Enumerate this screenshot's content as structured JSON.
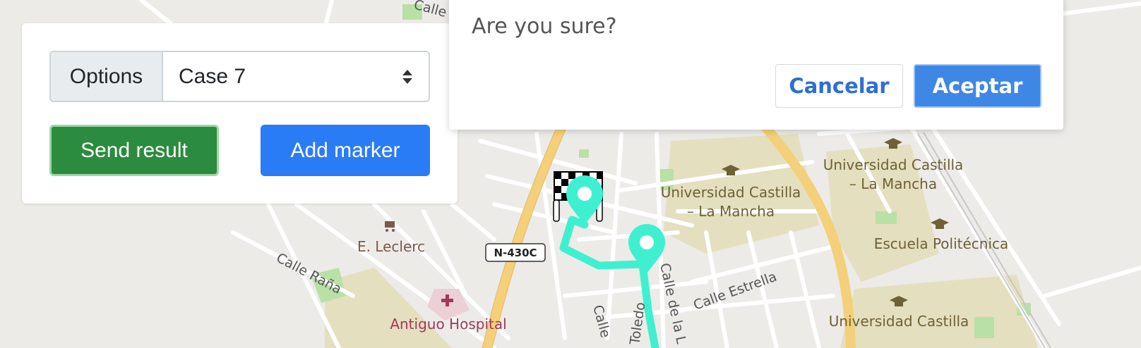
{
  "panel": {
    "options_label": "Options",
    "selected_case": "Case 7",
    "send_button": "Send result",
    "add_marker_button": "Add marker"
  },
  "dialog": {
    "title": "Are you sure?",
    "cancel_label": "Cancelar",
    "accept_label": "Aceptar"
  },
  "map": {
    "labels": {
      "uni1_l1": "Universidad Castilla",
      "uni1_l2": "– La Mancha",
      "uni2_l1": "Universidad Castilla",
      "uni2_l2": "– La Mancha",
      "escuela": "Escuela Politécnica",
      "uni3_l1": "Universidad Castilla",
      "leclerc": "E. Leclerc",
      "hospital": "Antiguo Hospital",
      "calle_rana": "Calle Raña",
      "calle_estrella": "Calle Estrella",
      "calle_dela": "Calle de la L",
      "calle_sol": "Calle Sol",
      "calle_small": "Calle",
      "toledo": "Toledo",
      "road_badge": "N-430C"
    }
  },
  "colors": {
    "route": "#3ff0d0",
    "marker": "#3ff0d0",
    "accent_blue": "#2a7cf6",
    "success_green": "#2b8b3e"
  }
}
